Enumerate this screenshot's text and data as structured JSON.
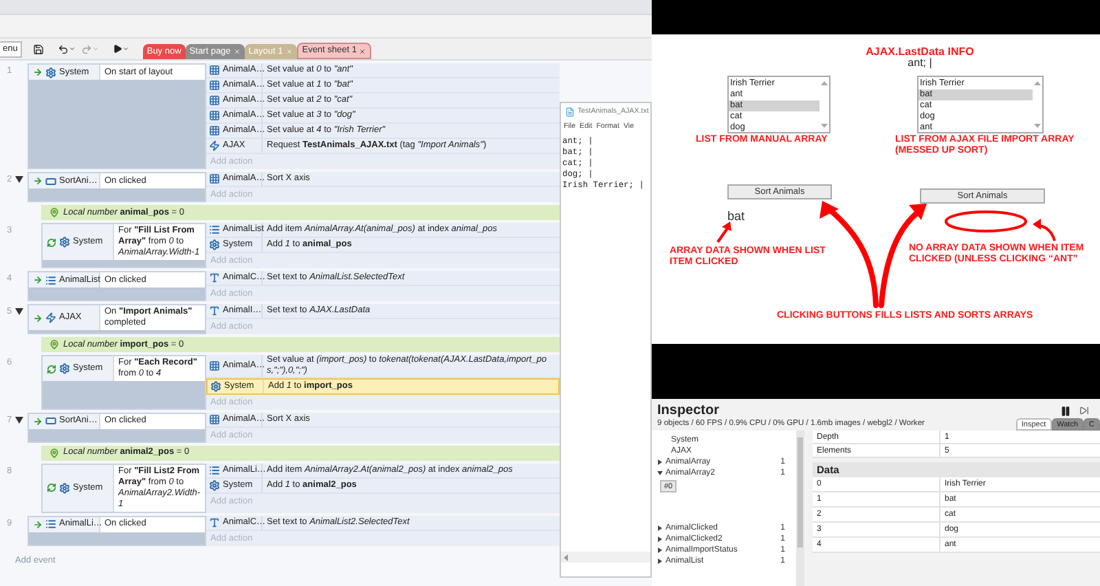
{
  "toolbar": {
    "menu": "enu",
    "tabs": [
      {
        "label": "Buy now",
        "selected": false,
        "color": "#e94b4b",
        "kind": "promo"
      },
      {
        "label": "Start page",
        "selected": false,
        "color": "#8d8d8d",
        "kind": "document"
      },
      {
        "label": "Layout 1",
        "selected": false,
        "color": "#c8b995",
        "kind": "document"
      },
      {
        "label": "Event sheet 1",
        "selected": true,
        "color": "#f6c3c3",
        "kind": "document"
      }
    ]
  },
  "events": [
    {
      "kind": "event",
      "number": "1",
      "trigger": {
        "kind": "trigger"
      },
      "object": {
        "kind": "system",
        "name": "System"
      },
      "condition": "On start of layout",
      "actions": [
        {
          "kind": "array",
          "object": "AnimalA…",
          "text": "Set value at *0* to *\"ant\"*",
          "selected": false
        },
        {
          "kind": "array",
          "object": "AnimalA…",
          "text": "Set value at *1* to *\"bat\"*",
          "selected": false
        },
        {
          "kind": "array",
          "object": "AnimalA…",
          "text": "Set value at *2* to *\"cat\"*",
          "selected": false
        },
        {
          "kind": "array",
          "object": "AnimalA…",
          "text": "Set value at *3* to *\"dog\"*",
          "selected": false
        },
        {
          "kind": "array",
          "object": "AnimalA…",
          "text": "Set value at *4* to *\"Irish Terrier\"*",
          "selected": false
        },
        {
          "kind": "ajax",
          "object": "AJAX",
          "text": "Request **TestAnimals_AJAX.txt** (tag *\"Import Animals\"*)",
          "selected": false
        }
      ],
      "add_action": "Add action"
    },
    {
      "kind": "event",
      "number": "2",
      "expanded": true,
      "trigger": {
        "kind": "trigger"
      },
      "object": {
        "kind": "button",
        "name": "SortAni…"
      },
      "condition": "On clicked",
      "actions": [
        {
          "kind": "array",
          "object": "AnimalA…",
          "text": "Sort X axis",
          "selected": false
        }
      ],
      "add_action": "Add action",
      "children": [
        {
          "kind": "local",
          "text": "*Local number* **animal_pos** = 0"
        },
        {
          "kind": "event",
          "number": "3",
          "trigger": {
            "kind": "loop"
          },
          "object": {
            "kind": "system",
            "name": "System"
          },
          "condition": "For **\"Fill List From Array\"** from *0* to *AnimalArray.Width-1*",
          "actions": [
            {
              "kind": "list",
              "object": "AnimalList",
              "text": "Add item *AnimalArray.At(animal_pos)* at index *animal_pos*",
              "selected": false
            },
            {
              "kind": "system",
              "object": "System",
              "text": "Add *1* to **animal_pos**",
              "selected": false
            }
          ],
          "add_action": "Add action"
        }
      ]
    },
    {
      "kind": "event",
      "number": "4",
      "trigger": {
        "kind": "trigger"
      },
      "object": {
        "kind": "list",
        "name": "AnimalList"
      },
      "condition": "On clicked",
      "actions": [
        {
          "kind": "text",
          "object": "AnimalC…",
          "text": "Set text to *AnimalList.SelectedText*",
          "selected": false
        }
      ],
      "add_action": "Add action"
    },
    {
      "kind": "event",
      "number": "5",
      "expanded": true,
      "trigger": {
        "kind": "trigger"
      },
      "object": {
        "kind": "ajax",
        "name": "AJAX"
      },
      "condition": "On **\"Import Animals\"** completed",
      "actions": [
        {
          "kind": "text",
          "object": "AnimalI…",
          "text": "Set text to *AJAX.LastData*",
          "selected": false
        }
      ],
      "add_action": "Add action",
      "children": [
        {
          "kind": "local",
          "text": "*Local number* **import_pos** = 0"
        },
        {
          "kind": "event",
          "number": "6",
          "trigger": {
            "kind": "loop"
          },
          "object": {
            "kind": "system",
            "name": "System"
          },
          "condition": "For **\"Each Record\"** from *0* to *4*",
          "actions": [
            {
              "kind": "array",
              "object": "AnimalA…",
              "text": "Set value at *(import_pos)* to *tokenat(tokenat(AJAX.LastData,import_pos,\";\"),0,\";\")*",
              "selected": false
            },
            {
              "kind": "system",
              "object": "System",
              "text": "Add *1* to **import_pos**",
              "selected": true
            }
          ],
          "add_action": "Add action"
        }
      ]
    },
    {
      "kind": "event",
      "number": "7",
      "expanded": true,
      "trigger": {
        "kind": "trigger"
      },
      "object": {
        "kind": "button",
        "name": "SortAni…"
      },
      "condition": "On clicked",
      "actions": [
        {
          "kind": "array",
          "object": "AnimalA…",
          "text": "Sort X axis",
          "selected": false
        }
      ],
      "add_action": "Add action",
      "children": [
        {
          "kind": "local",
          "text": "*Local number* **animal2_pos** = 0"
        },
        {
          "kind": "event",
          "number": "8",
          "trigger": {
            "kind": "loop"
          },
          "object": {
            "kind": "system",
            "name": "System"
          },
          "condition": "For **\"Fill List2 From Array\"** from *0* to *AnimalArray2.Width-1*",
          "actions": [
            {
              "kind": "list",
              "object": "AnimalLi…",
              "text": "Add item *AnimalArray2.At(animal2_pos)* at index *animal2_pos*",
              "selected": false
            },
            {
              "kind": "system",
              "object": "System",
              "text": "Add *1* to **animal2_pos**",
              "selected": false
            }
          ],
          "add_action": "Add action"
        }
      ]
    },
    {
      "kind": "event",
      "number": "9",
      "trigger": {
        "kind": "trigger"
      },
      "object": {
        "kind": "list",
        "name": "AnimalLi…"
      },
      "condition": "On clicked",
      "actions": [
        {
          "kind": "text",
          "object": "AnimalC…",
          "text": "Set text to *AnimalList2.SelectedText*",
          "selected": false
        }
      ],
      "add_action": "Add action"
    }
  ],
  "add_event": "Add event",
  "notepad": {
    "title": "TestAnimals_AJAX.txt",
    "menus": [
      "File",
      "Edit",
      "Format",
      "Vie"
    ],
    "lines": [
      "ant; |",
      "bat; |",
      "cat; |",
      "dog; |",
      "Irish Terrier; |"
    ]
  },
  "game": {
    "info_title": "AJAX.LastData INFO",
    "info_value": "ant; |",
    "lists": [
      {
        "items": [
          {
            "label": "Irish Terrier",
            "selected": false
          },
          {
            "label": "ant",
            "selected": false
          },
          {
            "label": "bat",
            "selected": true
          },
          {
            "label": "cat",
            "selected": false
          },
          {
            "label": "dog",
            "selected": false
          }
        ],
        "caption": "LIST FROM MANUAL ARRAY",
        "button": "Sort Animals",
        "output": "bat"
      },
      {
        "items": [
          {
            "label": "Irish Terrier",
            "selected": false
          },
          {
            "label": "bat",
            "selected": true
          },
          {
            "label": "cat",
            "selected": false
          },
          {
            "label": "dog",
            "selected": false
          },
          {
            "label": "ant",
            "selected": false
          }
        ],
        "caption": "LIST FROM AJAX FILE IMPORT ARRAY (MESSED UP SORT)",
        "button": "Sort Animals"
      }
    ],
    "notes": [
      "ARRAY DATA SHOWN WHEN LIST ITEM CLICKED",
      "NO ARRAY DATA SHOWN WHEN ITEM CLICKED (UNLESS CLICKING “ANT”",
      "CLICKING BUTTONS FILLS LISTS AND SORTS ARRAYS"
    ]
  },
  "inspector": {
    "title": "Inspector",
    "stats": "9 objects / 60 FPS / 0.9% CPU / 0% GPU / 1.6mb images / webgl2 / Worker",
    "tabs": [
      {
        "label": "Inspect",
        "selected": true
      },
      {
        "label": "Watch",
        "selected": false
      },
      {
        "label": "C",
        "selected": false
      }
    ],
    "objects": [
      {
        "name": "System"
      },
      {
        "name": "AJAX"
      },
      {
        "name": "AnimalArray",
        "count": "1",
        "expanded": false
      },
      {
        "name": "AnimalArray2",
        "count": "1",
        "expanded": true,
        "children": [
          {
            "name": "#0",
            "selected": true
          }
        ]
      },
      {
        "name": "AnimalClicked",
        "count": "1",
        "expanded": false
      },
      {
        "name": "AnimalClicked2",
        "count": "1",
        "expanded": false
      },
      {
        "name": "AnimalImportStatus",
        "count": "1",
        "expanded": false
      },
      {
        "name": "AnimalList",
        "count": "1",
        "expanded": false
      }
    ],
    "properties": [
      {
        "key": "Depth",
        "value": "1"
      },
      {
        "key": "Elements",
        "value": "5"
      }
    ],
    "data_title": "Data",
    "data": [
      {
        "key": "0",
        "value": "Irish Terrier"
      },
      {
        "key": "1",
        "value": "bat"
      },
      {
        "key": "2",
        "value": "cat"
      },
      {
        "key": "3",
        "value": "dog"
      },
      {
        "key": "4",
        "value": "ant"
      }
    ]
  }
}
